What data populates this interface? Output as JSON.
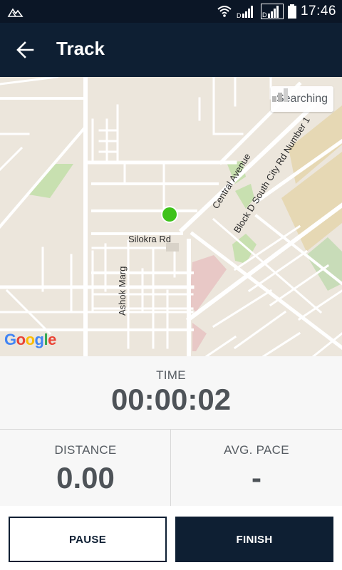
{
  "status_bar": {
    "time": "17:46"
  },
  "app_bar": {
    "title": "Track"
  },
  "map": {
    "gps_status": "Searching",
    "labels": {
      "silokra_rd": "Silokra Rd",
      "ashok_marg": "Ashok Marg",
      "central_avenue": "Central Avenue",
      "block_d": "Block D South City Rd Number 1"
    },
    "attribution": [
      "G",
      "o",
      "o",
      "g",
      "l",
      "e"
    ],
    "colors": {
      "background": "#ece6dc",
      "roads": "#ffffff",
      "park": "#c8e0b0",
      "highlight": "#e8c8c6",
      "landuse": "#e6d8b4",
      "location_dot": "#3ec21a"
    }
  },
  "stats": {
    "time": {
      "label": "TIME",
      "value": "00:00:02"
    },
    "distance": {
      "label": "DISTANCE",
      "value": "0.00"
    },
    "avg_pace": {
      "label": "AVG. PACE",
      "value": "-"
    }
  },
  "buttons": {
    "pause": "PAUSE",
    "finish": "FINISH"
  },
  "colors": {
    "app_bar": "#0e1f33",
    "status_bar": "#0b1626",
    "accent": "#0e1f33"
  }
}
